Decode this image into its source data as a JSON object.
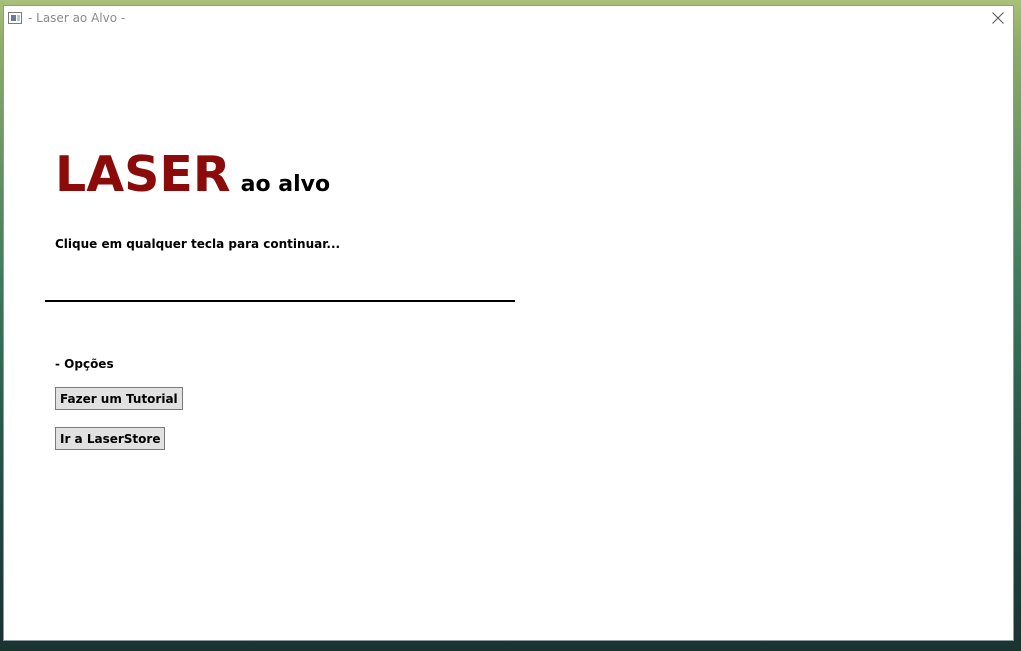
{
  "window": {
    "title": "- Laser ao Alvo -",
    "close_label": "close"
  },
  "brand": {
    "title": "LASER",
    "subtitle": "ao alvo",
    "title_color": "#8b0a0a"
  },
  "prompt": {
    "text": "Clique em qualquer tecla para continuar..."
  },
  "options": {
    "label": "- Opções",
    "buttons": [
      {
        "label": "Fazer um Tutorial"
      },
      {
        "label": "Ir a LaserStore"
      }
    ]
  },
  "icons": {
    "app": "app-window-icon",
    "close": "close-icon"
  }
}
